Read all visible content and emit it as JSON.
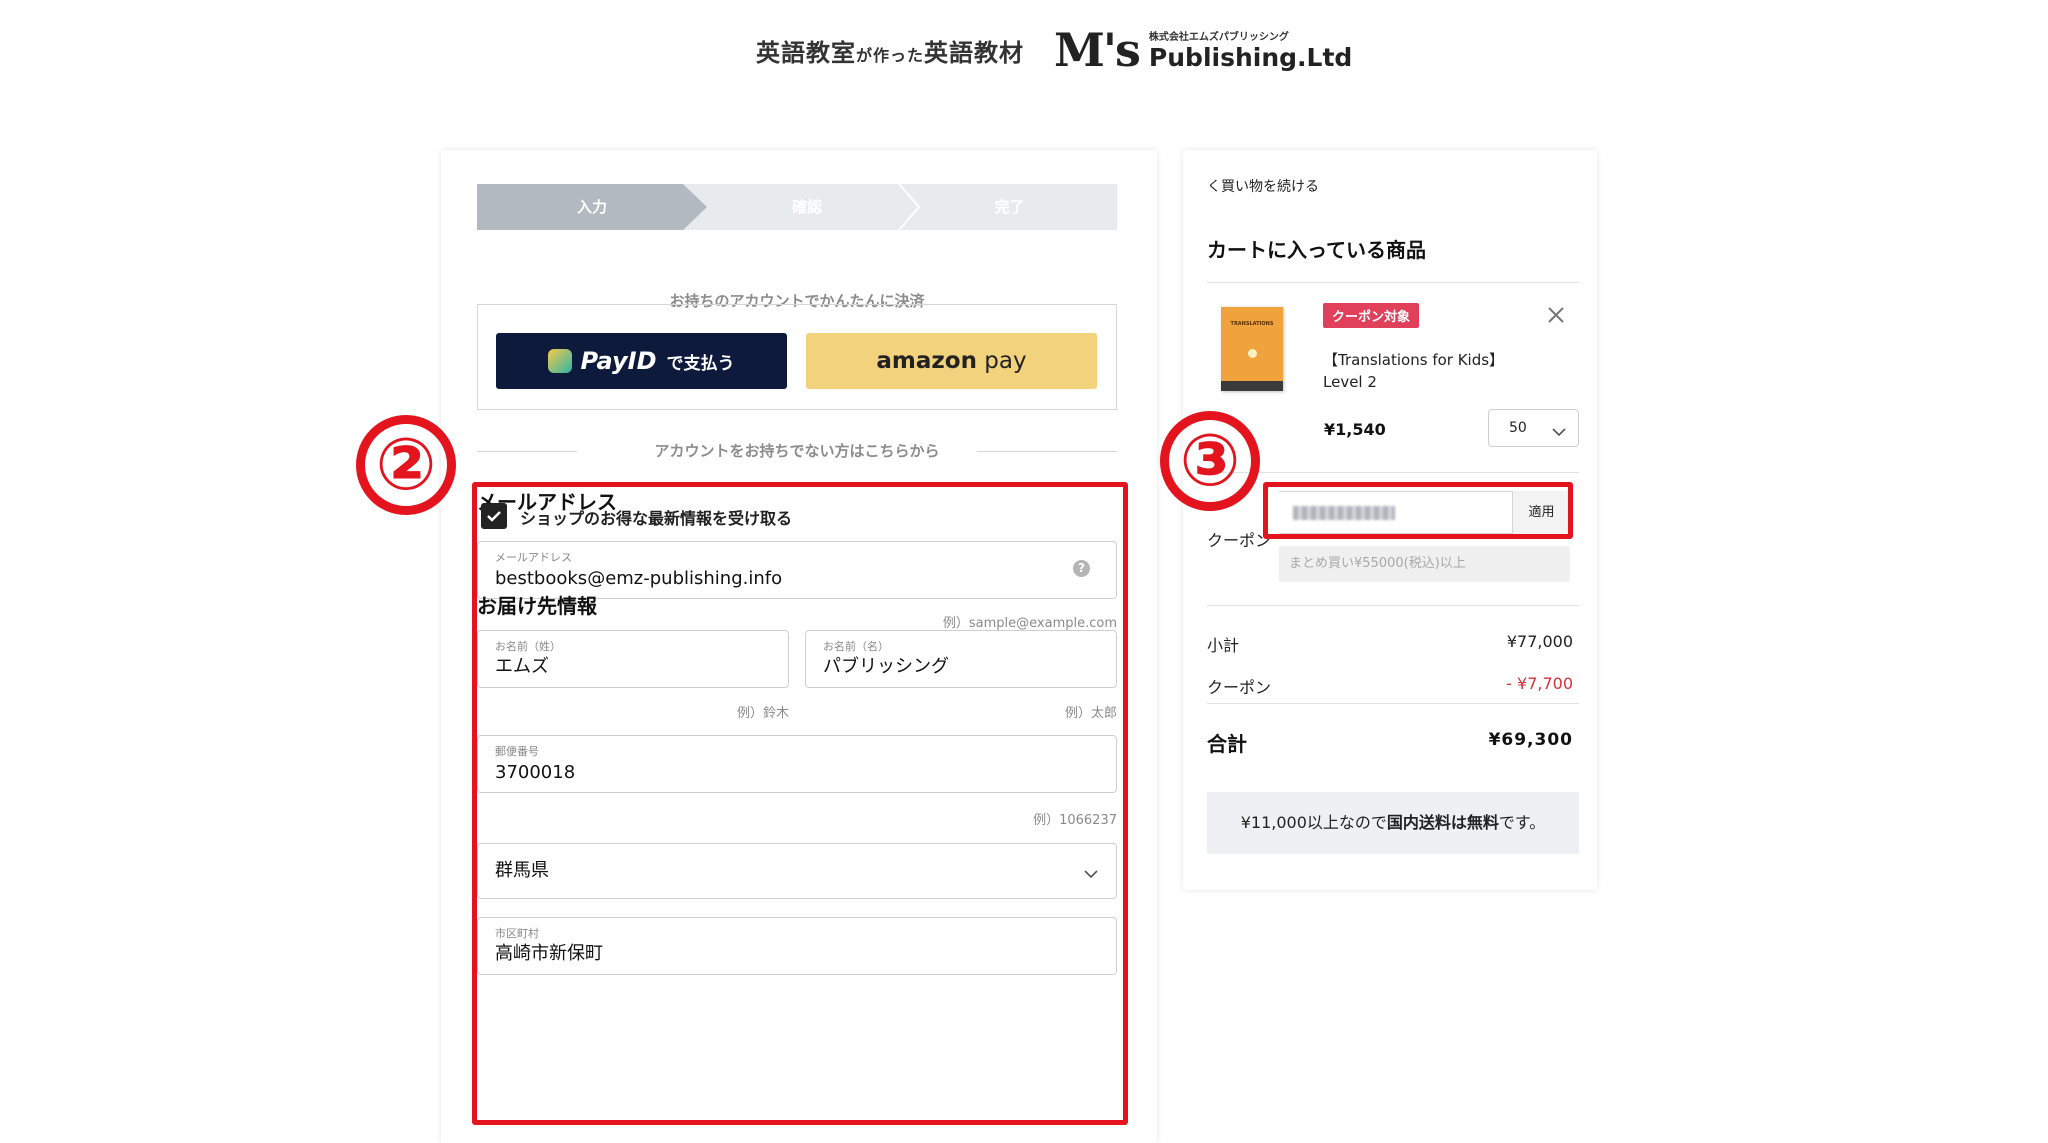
{
  "header": {
    "tagline_part1": "英語教室",
    "tagline_part2": "が作った",
    "tagline_part3": "英語教材",
    "logo_mark": "M's",
    "publisher_small": "株式会社エムズパブリッシング",
    "publisher_name": "Publishing.Ltd"
  },
  "stepper": {
    "steps": [
      {
        "label": "入力",
        "active": true
      },
      {
        "label": "確認",
        "active": false
      },
      {
        "label": "完了",
        "active": false
      }
    ]
  },
  "payment": {
    "account_heading": "お持ちのアカウントでかんたんに決済",
    "payid_logo": "PayID",
    "payid_suffix": "で支払う",
    "amazon_brand": "amazon",
    "amazon_suffix": "pay",
    "no_account_heading": "アカウントをお持ちでない方はこちらから"
  },
  "email_section": {
    "title": "メールアドレス",
    "field_label": "メールアドレス",
    "field_value": "bestbooks@emz-publishing.info",
    "hint": "例）sample@example.com",
    "help_icon": "?",
    "newsletter_label": "ショップのお得な最新情報を受け取る",
    "newsletter_checked": true
  },
  "shipping_section": {
    "title": "お届け先情報",
    "last_name_label": "お名前（姓）",
    "last_name_value": "エムズ",
    "last_name_hint": "例）鈴木",
    "first_name_label": "お名前（名）",
    "first_name_value": "パブリッシング",
    "first_name_hint": "例）太郎",
    "postal_label": "郵便番号",
    "postal_value": "3700018",
    "postal_hint": "例）1066237",
    "prefecture_value": "群馬県",
    "city_label": "市区町村",
    "city_value": "高崎市新保町"
  },
  "cart": {
    "back_link": "く買い物を続ける",
    "title": "カートに入っている商品",
    "item": {
      "badge": "クーポン対象",
      "name": "【Translations for Kids】 Level 2",
      "price": "¥1,540",
      "quantity": "50",
      "cover_title": "TRANSLATIONS"
    },
    "coupon_label": "クーポン",
    "apply_label": "適用",
    "coupon_condition": "まとめ買い¥55000(税込)以上",
    "subtotal_label": "小計",
    "subtotal_value": "¥77,000",
    "discount_label": "クーポン",
    "discount_value": "- ¥7,700",
    "total_label": "合計",
    "total_value": "¥69,300",
    "shipping_note_pre": "¥11,000以上なので",
    "shipping_note_bold": "国内送料は無料",
    "shipping_note_post": "です。"
  },
  "annotations": {
    "marker_2": "②",
    "marker_3": "③",
    "color": "#e3141d"
  },
  "colors": {
    "active_step": "#b2b9c1",
    "payid_bg": "#0e1a3c",
    "amazon_bg": "#f2d27c",
    "badge_bg": "#e0405a",
    "discount_text": "#d4323c"
  }
}
